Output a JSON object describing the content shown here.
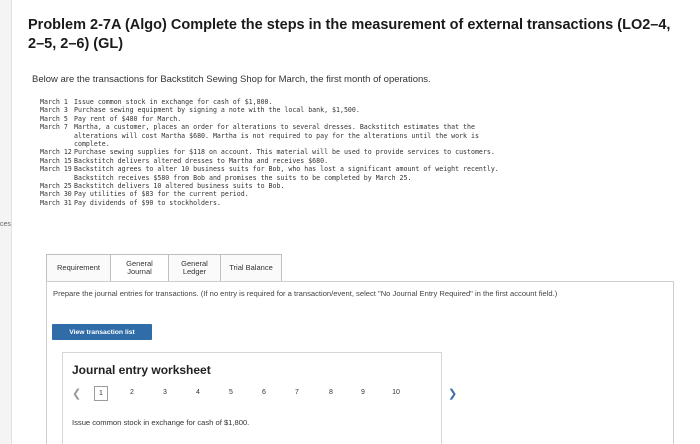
{
  "sidebar": {
    "cut_label": "ces"
  },
  "title": "Problem 2-7A (Algo) Complete the steps in the measurement of external transactions (LO2–4, 2–5, 2–6) (GL)",
  "intro": "Below are the transactions for Backstitch Sewing Shop for March, the first month of operations.",
  "transactions": [
    {
      "date": "March 1",
      "text": "Issue common stock in exchange for cash of $1,800."
    },
    {
      "date": "March 3",
      "text": "Purchase sewing equipment by signing a note with the local bank, $1,500."
    },
    {
      "date": "March 5",
      "text": "Pay rent of $480 for March."
    },
    {
      "date": "March 7",
      "text": "Martha, a customer, places an order for alterations to several dresses. Backstitch estimates that the\nalterations will cost Martha $680. Martha is not required to pay for the alterations until the work is\ncomplete."
    },
    {
      "date": "March 12",
      "text": "Purchase sewing supplies for $118 on account. This material will be used to provide services to customers."
    },
    {
      "date": "March 15",
      "text": "Backstitch delivers altered dresses to Martha and receives $680."
    },
    {
      "date": "March 19",
      "text": "Backstitch agrees to alter 10 business suits for Bob, who has lost a significant amount of weight recently.\nBackstitch receives $580 from Bob and promises the suits to be completed by March 25."
    },
    {
      "date": "March 25",
      "text": "Backstitch delivers 10 altered business suits to Bob."
    },
    {
      "date": "March 30",
      "text": "Pay utilities of $83 for the current period."
    },
    {
      "date": "March 31",
      "text": "Pay dividends of $90 to stockholders."
    }
  ],
  "tabs": [
    {
      "label": "Requirement"
    },
    {
      "label": "General Journal"
    },
    {
      "label": "General Ledger"
    },
    {
      "label": "Trial Balance"
    }
  ],
  "instructions": "Prepare the journal entries for transactions. (If no entry is required for a transaction/event, select \"No Journal Entry Required\" in the first account field.)",
  "view_button": "View transaction list",
  "worksheet": {
    "title": "Journal entry worksheet",
    "pages": [
      "1",
      "2",
      "3",
      "4",
      "5",
      "6",
      "7",
      "8",
      "9",
      "10"
    ],
    "current_page": "1",
    "prev_icon": "chevron-left-icon",
    "next_icon": "chevron-right-icon",
    "description": "Issue common stock in exchange for cash of $1,800."
  },
  "colors": {
    "button_blue": "#2f6ca8",
    "next_arrow": "#3b6ea6"
  }
}
